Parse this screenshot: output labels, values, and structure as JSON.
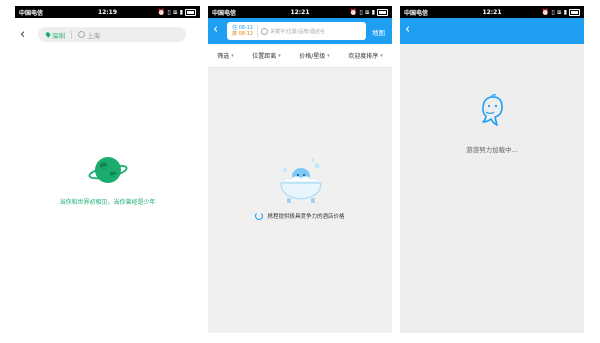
{
  "status_bars": [
    {
      "carrier": "中国电信",
      "time": "12:19"
    },
    {
      "carrier": "中国电信",
      "time": "12:21"
    },
    {
      "carrier": "中国电信",
      "time": "12:21"
    }
  ],
  "screen1": {
    "from_city": "深圳",
    "to_city": "上海",
    "message": "当你和世界初相见，当你曾经是少年",
    "colors": {
      "accent": "#1aad6f"
    }
  },
  "screen2": {
    "checkin_date": "住 08-11",
    "checkout_date": "离 08-12",
    "search_placeholder": "关键字/位置/品牌/酒店名",
    "map_label": "地图",
    "filters": [
      {
        "label": "筛选"
      },
      {
        "label": "位置距离"
      },
      {
        "label": "价格/星级"
      },
      {
        "label": "欢迎度排序"
      }
    ],
    "loading_text": "携程提供极具竞争力的酒店价格",
    "colors": {
      "header": "#1e9ff2"
    }
  },
  "screen3": {
    "loading_text": "游游努力加载中...",
    "colors": {
      "header": "#1e9ff2"
    }
  }
}
